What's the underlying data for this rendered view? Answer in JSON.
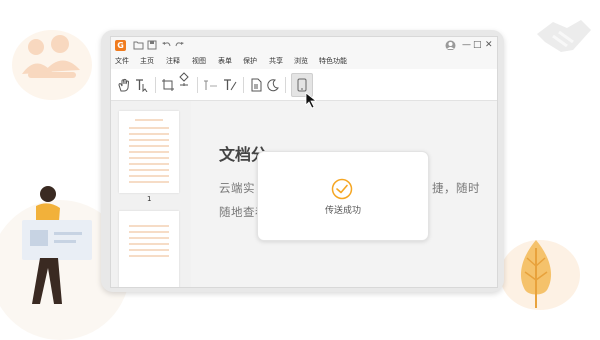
{
  "app": {
    "logo_letter": "G",
    "window_controls": [
      "—",
      "□",
      "✕"
    ]
  },
  "menu": {
    "items": [
      "文件",
      "主页",
      "注释",
      "视图",
      "表单",
      "保护",
      "共享",
      "浏览",
      "特色功能"
    ]
  },
  "toolbar": {
    "tools": [
      "hand-tool",
      "select-text-tool",
      "crop-tool",
      "shapes-tool",
      "text-field-tool",
      "typewriter-tool",
      "page-tool",
      "night-mode-tool",
      "send-to-phone-tool"
    ],
    "active_tool": "send-to-phone-tool"
  },
  "thumbnails": {
    "page_label": "1"
  },
  "document": {
    "title": "文档分",
    "line1": "云端实",
    "line1_tail": "捷，随时",
    "line2": "随地查看"
  },
  "toast": {
    "message": "传送成功",
    "icon": "check-circle-icon"
  },
  "colors": {
    "accent": "#f5a623",
    "logo": "#f07b1e",
    "thumb_line": "#f6dcc6"
  }
}
